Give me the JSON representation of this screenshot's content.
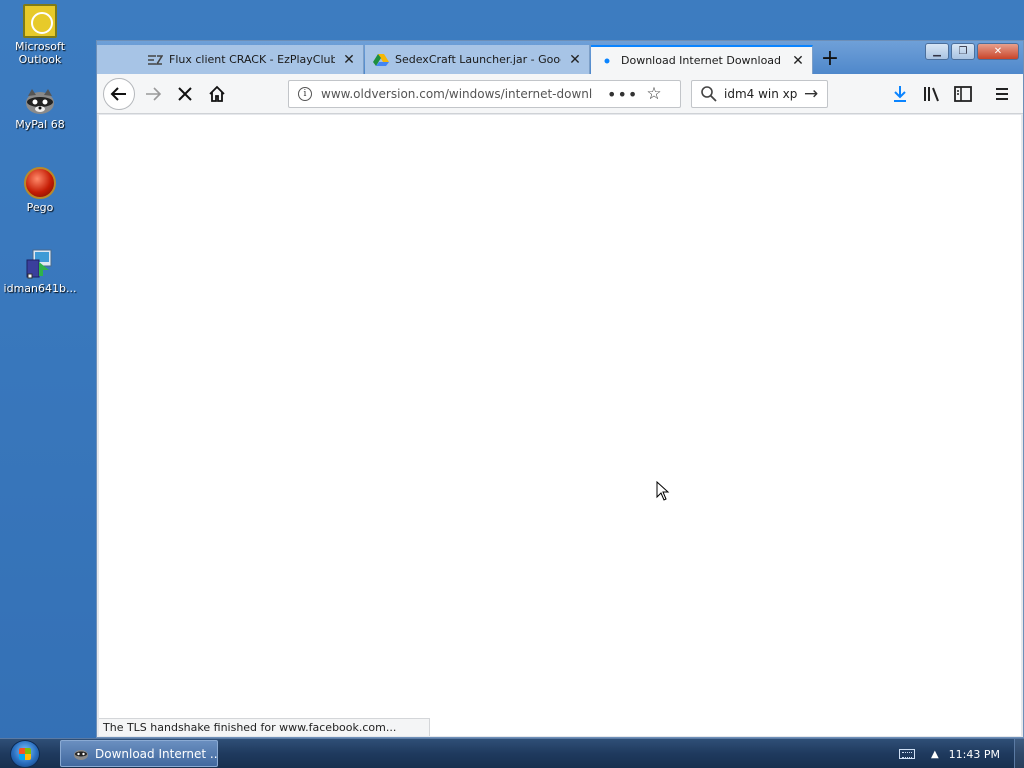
{
  "desktop": {
    "icons": [
      {
        "label": "Microsoft Outlook",
        "icon": "outlook-icon"
      },
      {
        "label": "MyPal 68",
        "icon": "mypal-icon"
      },
      {
        "label": "Pego",
        "icon": "pego-icon"
      },
      {
        "label": "idman641b...",
        "icon": "idm-installer-icon"
      }
    ]
  },
  "browser": {
    "tabs": [
      {
        "title": "Flux client CRACK - EzPlayClub",
        "favicon": "ez-icon",
        "active": false
      },
      {
        "title": "SedexCraft Launcher.jar - Googl",
        "favicon": "google-drive-icon",
        "active": false
      },
      {
        "title": "Download Internet Download M",
        "favicon": "loading-dot-icon",
        "active": true
      }
    ],
    "new_tab_label": "+",
    "url": "www.oldversion.com/windows/internet-downlo",
    "search_value": "idm4 win xp",
    "status_text": "The TLS handshake finished for www.facebook.com...",
    "accent_color": "#0a84ff"
  },
  "taskbar": {
    "active_task_label": "Download Internet ...",
    "clock": "11:43 PM"
  }
}
